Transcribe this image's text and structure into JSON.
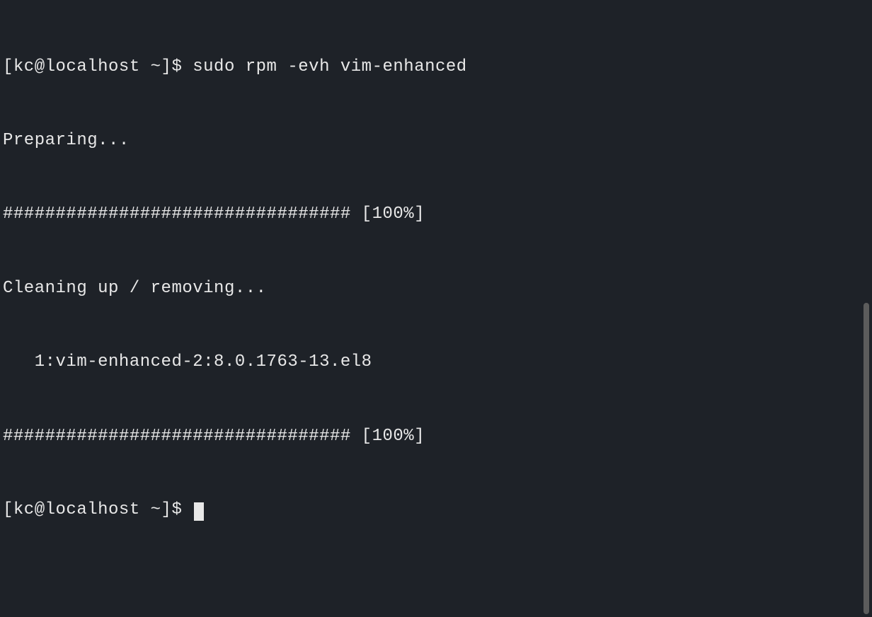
{
  "terminal": {
    "lines": [
      "[kc@localhost ~]$ sudo rpm -evh vim-enhanced",
      "Preparing...",
      "################################# [100%]",
      "Cleaning up / removing...",
      "   1:vim-enhanced-2:8.0.1763-13.el8",
      "################################# [100%]"
    ],
    "prompt": "[kc@localhost ~]$ "
  }
}
